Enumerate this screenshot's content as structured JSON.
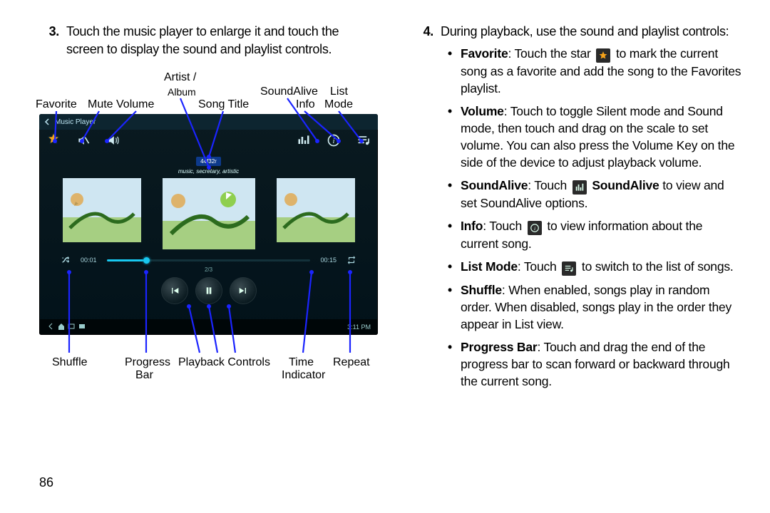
{
  "page_number": "86",
  "left": {
    "step_num": "3.",
    "step_text": "Touch the music player to enlarge it and touch the screen to display the sound and playlist controls.",
    "labels": {
      "favorite": "Favorite",
      "mute": "Mute",
      "volume": "Volume",
      "artist_album_l1": "Artist /",
      "artist_album_l2": "Album",
      "song_title": "Song Title",
      "soundalive": "SoundAlive",
      "info": "Info",
      "list_mode_l1": "List",
      "list_mode_l2": "Mode",
      "shuffle": "Shuffle",
      "progress_bar_l1": "Progress",
      "progress_bar_l2": "Bar",
      "playback_controls": "Playback Controls",
      "time_ind_l1": "Time",
      "time_ind_l2": "Indicator",
      "repeat": "Repeat"
    },
    "player": {
      "app_title": "Music Player",
      "track_id": "44f32r",
      "track_sub": "music, secretary, artistic",
      "time_elapsed": "00:01",
      "time_total": "00:15",
      "frac": "2/3",
      "clock": "3:11 PM"
    }
  },
  "right": {
    "step_num": "4.",
    "step_text": "During playback, use the sound and playlist controls:",
    "items": {
      "fav_b": "Favorite",
      "fav_t1": ": Touch the star ",
      "fav_t2": " to mark the current song as a favorite and add the song to the Favorites playlist.",
      "vol_b": "Volume",
      "vol_t": ": Touch to toggle Silent mode and Sound mode, then touch and drag on the scale to set volume. You can also press the Volume Key on the side of the device to adjust playback volume.",
      "sa_b": "SoundAlive",
      "sa_t1": ": Touch ",
      "sa_mid_b": "SoundAlive",
      "sa_t2": " to view and set SoundAlive options.",
      "info_b": "Info",
      "info_t1": ": Touch ",
      "info_t2": " to view information about the current song.",
      "lm_b": "List Mode",
      "lm_t1": ": Touch ",
      "lm_t2": " to switch to the list of songs.",
      "shuf_b": "Shuffle",
      "shuf_t": ": When enabled, songs play in random order. When disabled, songs play in the order they appear in List view.",
      "pb_b": "Progress Bar",
      "pb_t": ": Touch and drag the end of the progress bar to scan forward or backward through the current song."
    }
  }
}
